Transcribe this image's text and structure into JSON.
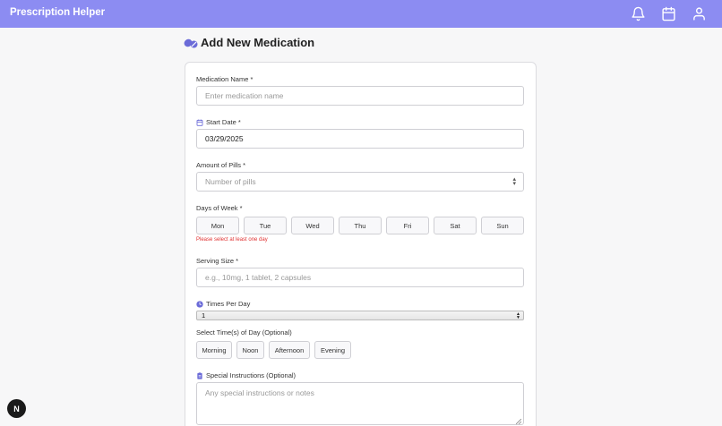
{
  "app": {
    "title": "Prescription Helper"
  },
  "topbar": {
    "icons": [
      "bell-icon",
      "calendar-icon",
      "user-icon"
    ]
  },
  "page": {
    "title": "Add New Medication",
    "icon": "pill-icon"
  },
  "form": {
    "medication_name": {
      "label": "Medication Name *",
      "placeholder": "Enter medication name"
    },
    "start_date": {
      "label": "Start Date *",
      "value": "03/29/2025",
      "icon": "calendar-icon"
    },
    "pills": {
      "label": "Amount of Pills *",
      "placeholder": "Number of pills"
    },
    "days": {
      "label": "Days of Week *",
      "items": [
        "Mon",
        "Tue",
        "Wed",
        "Thu",
        "Fri",
        "Sat",
        "Sun"
      ],
      "error": "Please select at least one day"
    },
    "serving_size": {
      "label": "Serving Size *",
      "placeholder": "e.g., 10mg, 1 tablet, 2 capsules"
    },
    "times_per_day": {
      "label": "Times Per Day",
      "value": "1",
      "icon": "clock-icon"
    },
    "time_of_day": {
      "label": "Select Time(s) of Day (Optional)",
      "items": [
        "Morning",
        "Noon",
        "Afternoon",
        "Evening"
      ]
    },
    "instructions": {
      "label": "Special Instructions (Optional)",
      "placeholder": "Any special instructions or notes",
      "icon": "clipboard-icon"
    }
  },
  "badge": {
    "letter": "N"
  },
  "colors": {
    "header": "#8c8cf2",
    "accent": "#6b6bd8",
    "error": "#e03131"
  }
}
